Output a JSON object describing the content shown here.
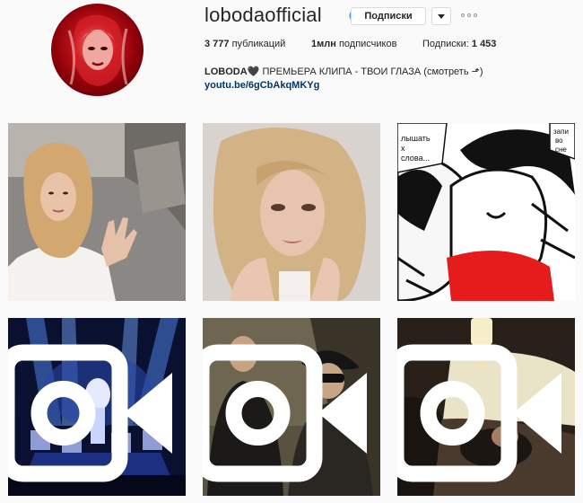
{
  "profile": {
    "username": "lobodaofficial",
    "follow_label": "Подписки",
    "posts_count": "3 777",
    "posts_label": "публикаций",
    "followers_count": "1млн",
    "followers_label": "подписчиков",
    "following_label": "Подписки:",
    "following_count": "1 453",
    "bio_name": "LOBODA",
    "bio_text": "ПРЕМЬЕРА КЛИПА - ТВОИ ГЛАЗА (смотреть ⬏)",
    "bio_link": "youtu.be/6gCbAkqMKYg"
  },
  "icons": {
    "verified": "verified-badge-icon",
    "dropdown": "chevron-down-icon",
    "more": "more-options-icon",
    "video": "video-camera-icon"
  },
  "colors": {
    "verified_blue": "#3897f0",
    "link_blue": "#003569",
    "avatar_red": "#c0131c"
  },
  "posts": [
    {
      "type": "photo"
    },
    {
      "type": "photo"
    },
    {
      "type": "photo",
      "comic_text_left": "лышать\nх\nслова...",
      "comic_text_right": "запи\nво\nсне"
    },
    {
      "type": "video"
    },
    {
      "type": "video"
    },
    {
      "type": "video"
    }
  ]
}
